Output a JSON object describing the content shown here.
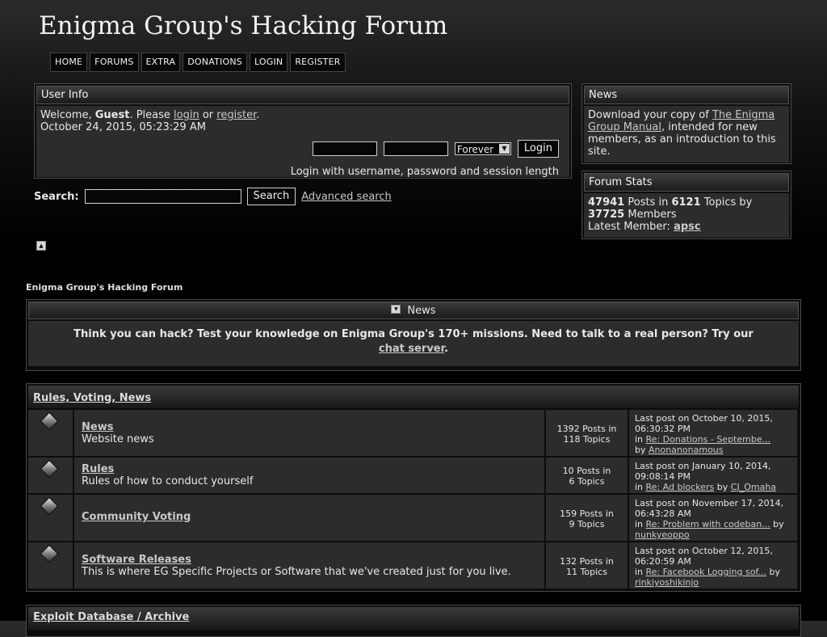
{
  "site": {
    "title": "Enigma Group's Hacking Forum"
  },
  "nav": [
    "HOME",
    "FORUMS",
    "EXTRA",
    "DONATIONS",
    "LOGIN",
    "REGISTER"
  ],
  "userinfo": {
    "heading": "User Info",
    "welcome_prefix": "Welcome, ",
    "guest": "Guest",
    "please": ". Please ",
    "login_link": "login",
    "or": " or ",
    "register_link": "register",
    "period": ".",
    "datetime": "October 24, 2015, 05:23:29 AM",
    "session_select": "Forever",
    "login_button": "Login",
    "login_hint": "Login with username, password and session length"
  },
  "search": {
    "label": "Search:",
    "button": "Search",
    "advanced": "Advanced search"
  },
  "news_sidebar": {
    "heading": "News",
    "text_before": "Download your copy of ",
    "link": "The Enigma Group Manual",
    "text_after": ", intended for new members, as an introduction to this site."
  },
  "stats_sidebar": {
    "heading": "Forum Stats",
    "posts": "47941",
    "posts_in": " Posts in ",
    "topics": "6121",
    "topics_by": " Topics by",
    "members": "37725",
    "members_label": " Members",
    "latest_label": "Latest Member: ",
    "latest_member": "apsc"
  },
  "linktree": "Enigma Group's Hacking Forum",
  "newsbox": {
    "heading": "News",
    "text": "Think you can hack? Test your knowledge on Enigma Group's 170+ missions. Need to talk to a real person? Try our",
    "link": "chat server",
    "end": "."
  },
  "category": {
    "name": "Rules, Voting, News",
    "boards": [
      {
        "name": "News",
        "desc": "Website news",
        "posts": "1392 Posts in",
        "topics": "118 Topics",
        "last_post": "Last post on October 10, 2015, 06:30:32 PM",
        "in": "in ",
        "topic_link": "Re: Donations - Septembe...",
        "by": "by ",
        "user": "Anonanonamous"
      },
      {
        "name": "Rules",
        "desc": "Rules of how to conduct yourself",
        "posts": "10 Posts in",
        "topics": "6 Topics",
        "last_post": "Last post on January 10, 2014, 09:08:14 PM",
        "in": "in ",
        "topic_link": "Re: Ad blockers",
        "by": " by ",
        "user": "CJ_Omaha"
      },
      {
        "name": "Community Voting",
        "desc": "",
        "posts": "159 Posts in",
        "topics": "9 Topics",
        "last_post": "Last post on November 17, 2014, 06:43:28 AM",
        "in": "in ",
        "topic_link": "Re: Problem with codeban...",
        "by": " by ",
        "user": "nunkyeoppo"
      },
      {
        "name": "Software Releases",
        "desc": "This is where EG Specific Projects or Software that we've created just for you live.",
        "posts": "132 Posts in",
        "topics": "11 Topics",
        "last_post": "Last post on October 12, 2015, 06:20:59 AM",
        "in": "in ",
        "topic_link": "Re: Facebook Logging sof...",
        "by": " by ",
        "user": "rinkiyoshikinjo"
      }
    ]
  },
  "category2": {
    "name": "Exploit Database / Archive"
  }
}
